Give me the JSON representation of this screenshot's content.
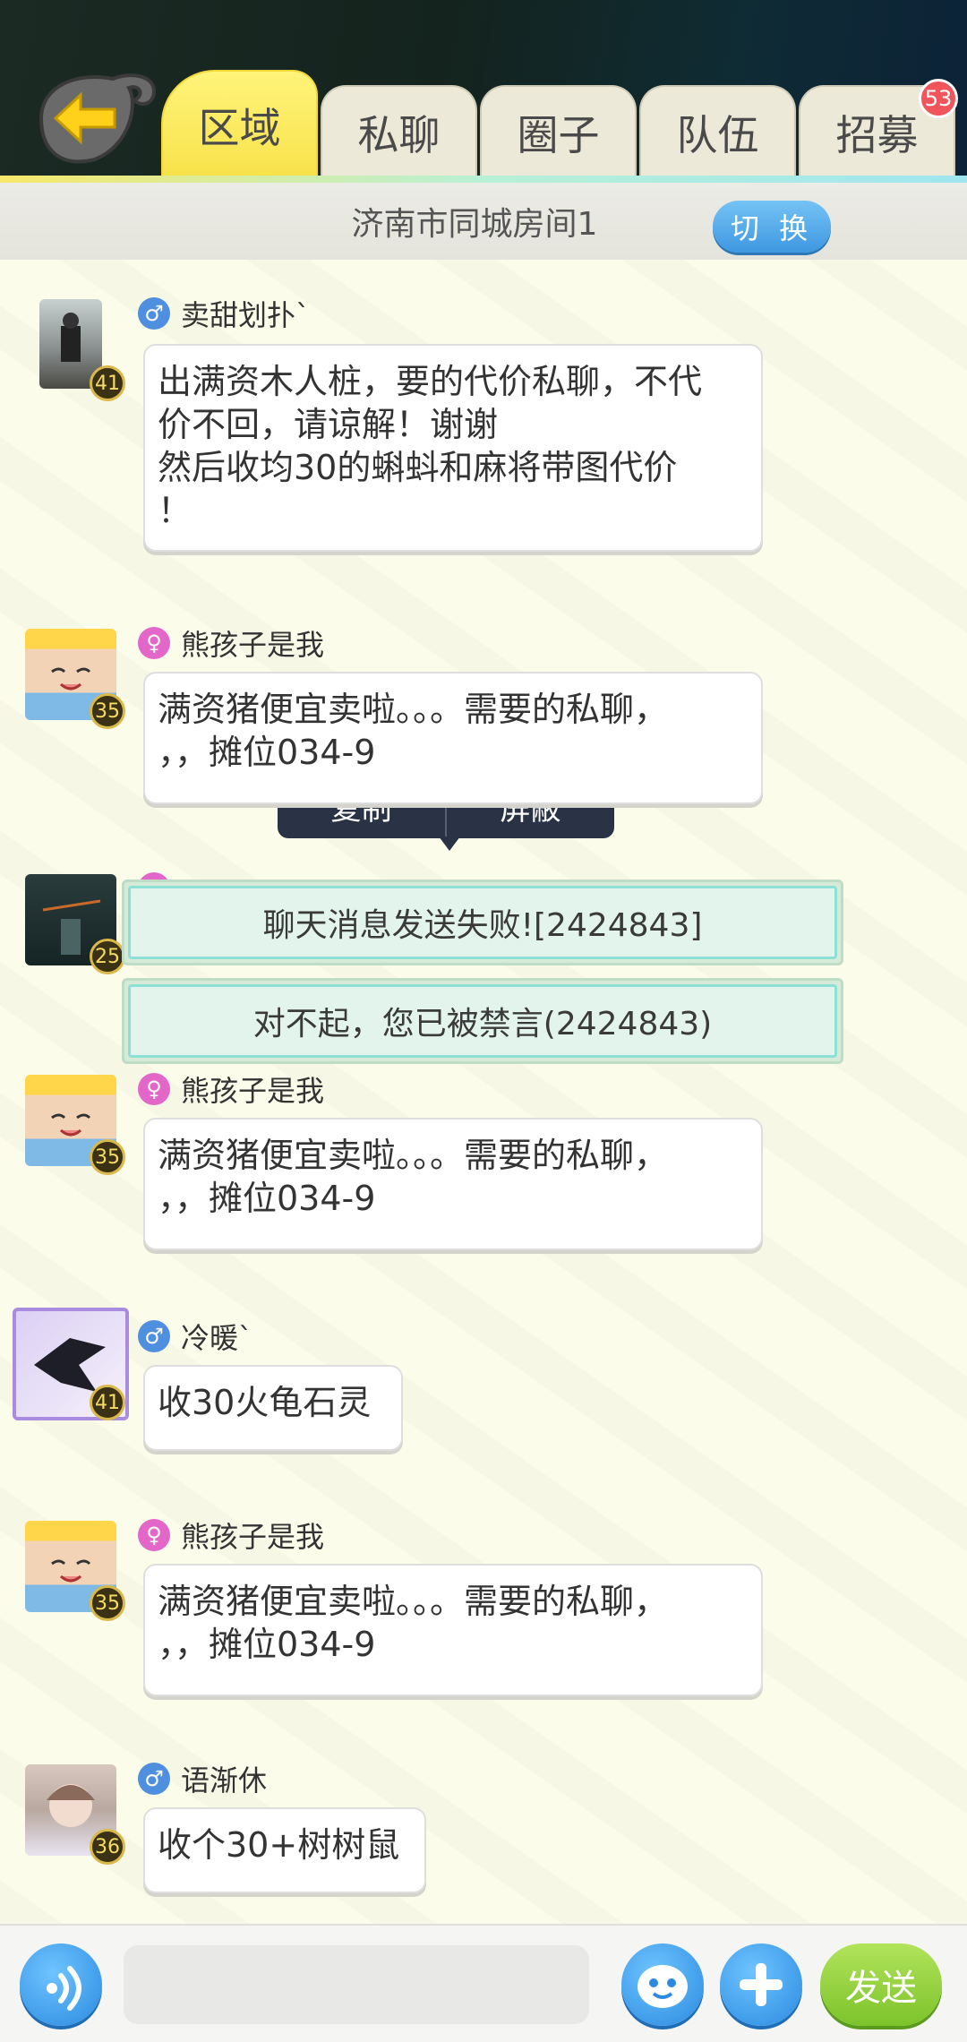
{
  "header": {
    "tabs": [
      {
        "label": "区域"
      },
      {
        "label": "私聊"
      },
      {
        "label": "圈子"
      },
      {
        "label": "队伍"
      },
      {
        "label": "招募"
      }
    ],
    "recruit_badge": "53"
  },
  "room": {
    "title": "济南市同城房间1",
    "switch_label": "切 换"
  },
  "context_menu": {
    "copy": "复制",
    "block": "屏蔽"
  },
  "messages": [
    {
      "name": "卖甜划扑`",
      "gender": "male",
      "level": "41",
      "text": "出满资木人桩，要的代价私聊，不代\n价不回，请谅解！谢谢\n然后收均30的蝌蚪和麻将带图代价\n！"
    },
    {
      "name": "熊孩子是我",
      "gender": "female",
      "level": "35",
      "text": "满资猪便宜卖啦。。。需要的私聊，\n，，摊位034-9"
    },
    {
      "name": "",
      "gender": "female",
      "level": "25",
      "text": ""
    },
    {
      "name": "熊孩子是我",
      "gender": "female",
      "level": "35",
      "text": "满资猪便宜卖啦。。。需要的私聊，\n，，摊位034-9"
    },
    {
      "name": "冷暖`",
      "gender": "male",
      "level": "41",
      "text": "收30火龟石灵"
    },
    {
      "name": "熊孩子是我",
      "gender": "female",
      "level": "35",
      "text": "满资猪便宜卖啦。。。需要的私聊，\n，，摊位034-9"
    },
    {
      "name": "语渐休",
      "gender": "male",
      "level": "36",
      "text": "收个30+树树鼠"
    }
  ],
  "toasts": [
    "聊天消息发送失败![2424843]",
    "对不起，您已被禁言(2424843)"
  ],
  "bottom": {
    "send_label": "发送",
    "input_placeholder": ""
  },
  "colors": {
    "accent_yellow": "#f8e24a",
    "blue_button": "#3e97e0",
    "send_green": "#7cc32b",
    "male": "#4f8fe0",
    "female": "#e366c9"
  }
}
